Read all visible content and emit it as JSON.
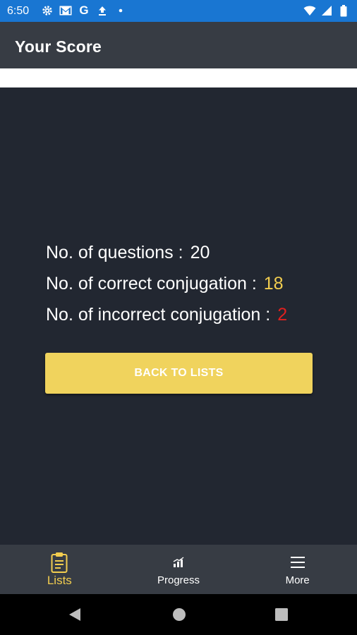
{
  "status_bar": {
    "time": "6:50",
    "g_letter": "G",
    "icons_left": [
      "settings-icon",
      "gmail-icon",
      "google-icon",
      "upload-icon",
      "dot-icon"
    ],
    "icons_right": [
      "wifi-icon",
      "cell-signal-icon",
      "battery-icon"
    ]
  },
  "app_bar": {
    "title": "Your Score"
  },
  "score": {
    "questions_label": "No. of questions :",
    "questions_value": "20",
    "correct_label": "No. of correct conjugation :",
    "correct_value": "18",
    "incorrect_label": "No. of incorrect conjugation :",
    "incorrect_value": "2"
  },
  "back_button": {
    "label": "BACK TO LISTS"
  },
  "bottom_nav": {
    "lists_label": "Lists",
    "progress_label": "Progress",
    "more_label": "More",
    "active": "Lists"
  },
  "colors": {
    "accent": "#f2cd4f",
    "button": "#f0d35d",
    "incorrect": "#e0201f",
    "status_bar": "#1976d2",
    "app_bar": "#373c44",
    "background": "#222731"
  }
}
